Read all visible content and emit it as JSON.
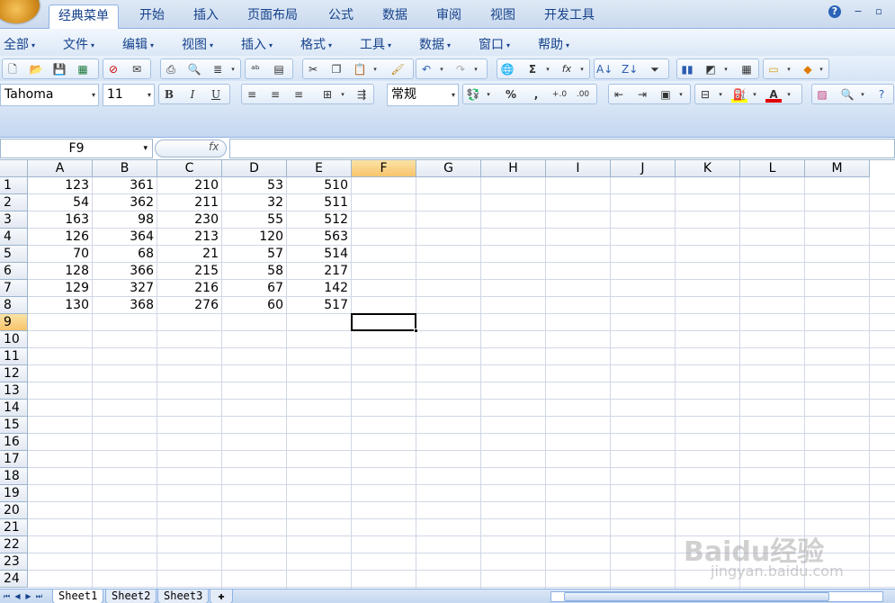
{
  "ribbon": {
    "tabs": [
      "经典菜单",
      "开始",
      "插入",
      "页面布局",
      "公式",
      "数据",
      "审阅",
      "视图",
      "开发工具"
    ],
    "active_tab": "经典菜单"
  },
  "menus": [
    "全部",
    "文件",
    "编辑",
    "视图",
    "插入",
    "格式",
    "工具",
    "数据",
    "窗口",
    "帮助"
  ],
  "toolbar": {
    "font_name": "Tahoma",
    "font_size": "11",
    "bold": "B",
    "italic": "I",
    "underline": "U",
    "number_format": "常规",
    "percent": "%",
    "comma": ",",
    "sum": "Σ",
    "fx": "fx",
    "font_color_letter": "A"
  },
  "formula_bar": {
    "name_box": "F9",
    "fx_label": "fx",
    "formula": ""
  },
  "grid": {
    "columns": [
      "A",
      "B",
      "C",
      "D",
      "E",
      "F",
      "G",
      "H",
      "I",
      "J",
      "K",
      "L",
      "M"
    ],
    "selected_column": "F",
    "rows": [
      "1",
      "2",
      "3",
      "4",
      "5",
      "6",
      "7",
      "8",
      "9",
      "10",
      "11",
      "12",
      "13",
      "14",
      "15",
      "16",
      "17",
      "18",
      "19",
      "20",
      "21",
      "22",
      "23",
      "24"
    ],
    "selected_row": "9",
    "active_cell": "F9",
    "data": [
      [
        "123",
        "361",
        "210",
        "53",
        "510"
      ],
      [
        "54",
        "362",
        "211",
        "32",
        "511"
      ],
      [
        "163",
        "98",
        "230",
        "55",
        "512"
      ],
      [
        "126",
        "364",
        "213",
        "120",
        "563"
      ],
      [
        "70",
        "68",
        "21",
        "57",
        "514"
      ],
      [
        "128",
        "366",
        "215",
        "58",
        "217"
      ],
      [
        "129",
        "327",
        "216",
        "67",
        "142"
      ],
      [
        "130",
        "368",
        "276",
        "60",
        "517"
      ]
    ]
  },
  "sheets": [
    "Sheet1",
    "Sheet2",
    "Sheet3"
  ],
  "active_sheet": "Sheet1",
  "watermark": {
    "brand": "Baidu经验",
    "url": "jingyan.baidu.com"
  },
  "colors": {
    "selection_header": "#f7c46c",
    "ribbon_text": "#15428b",
    "grid_line": "#d0d7e5"
  }
}
